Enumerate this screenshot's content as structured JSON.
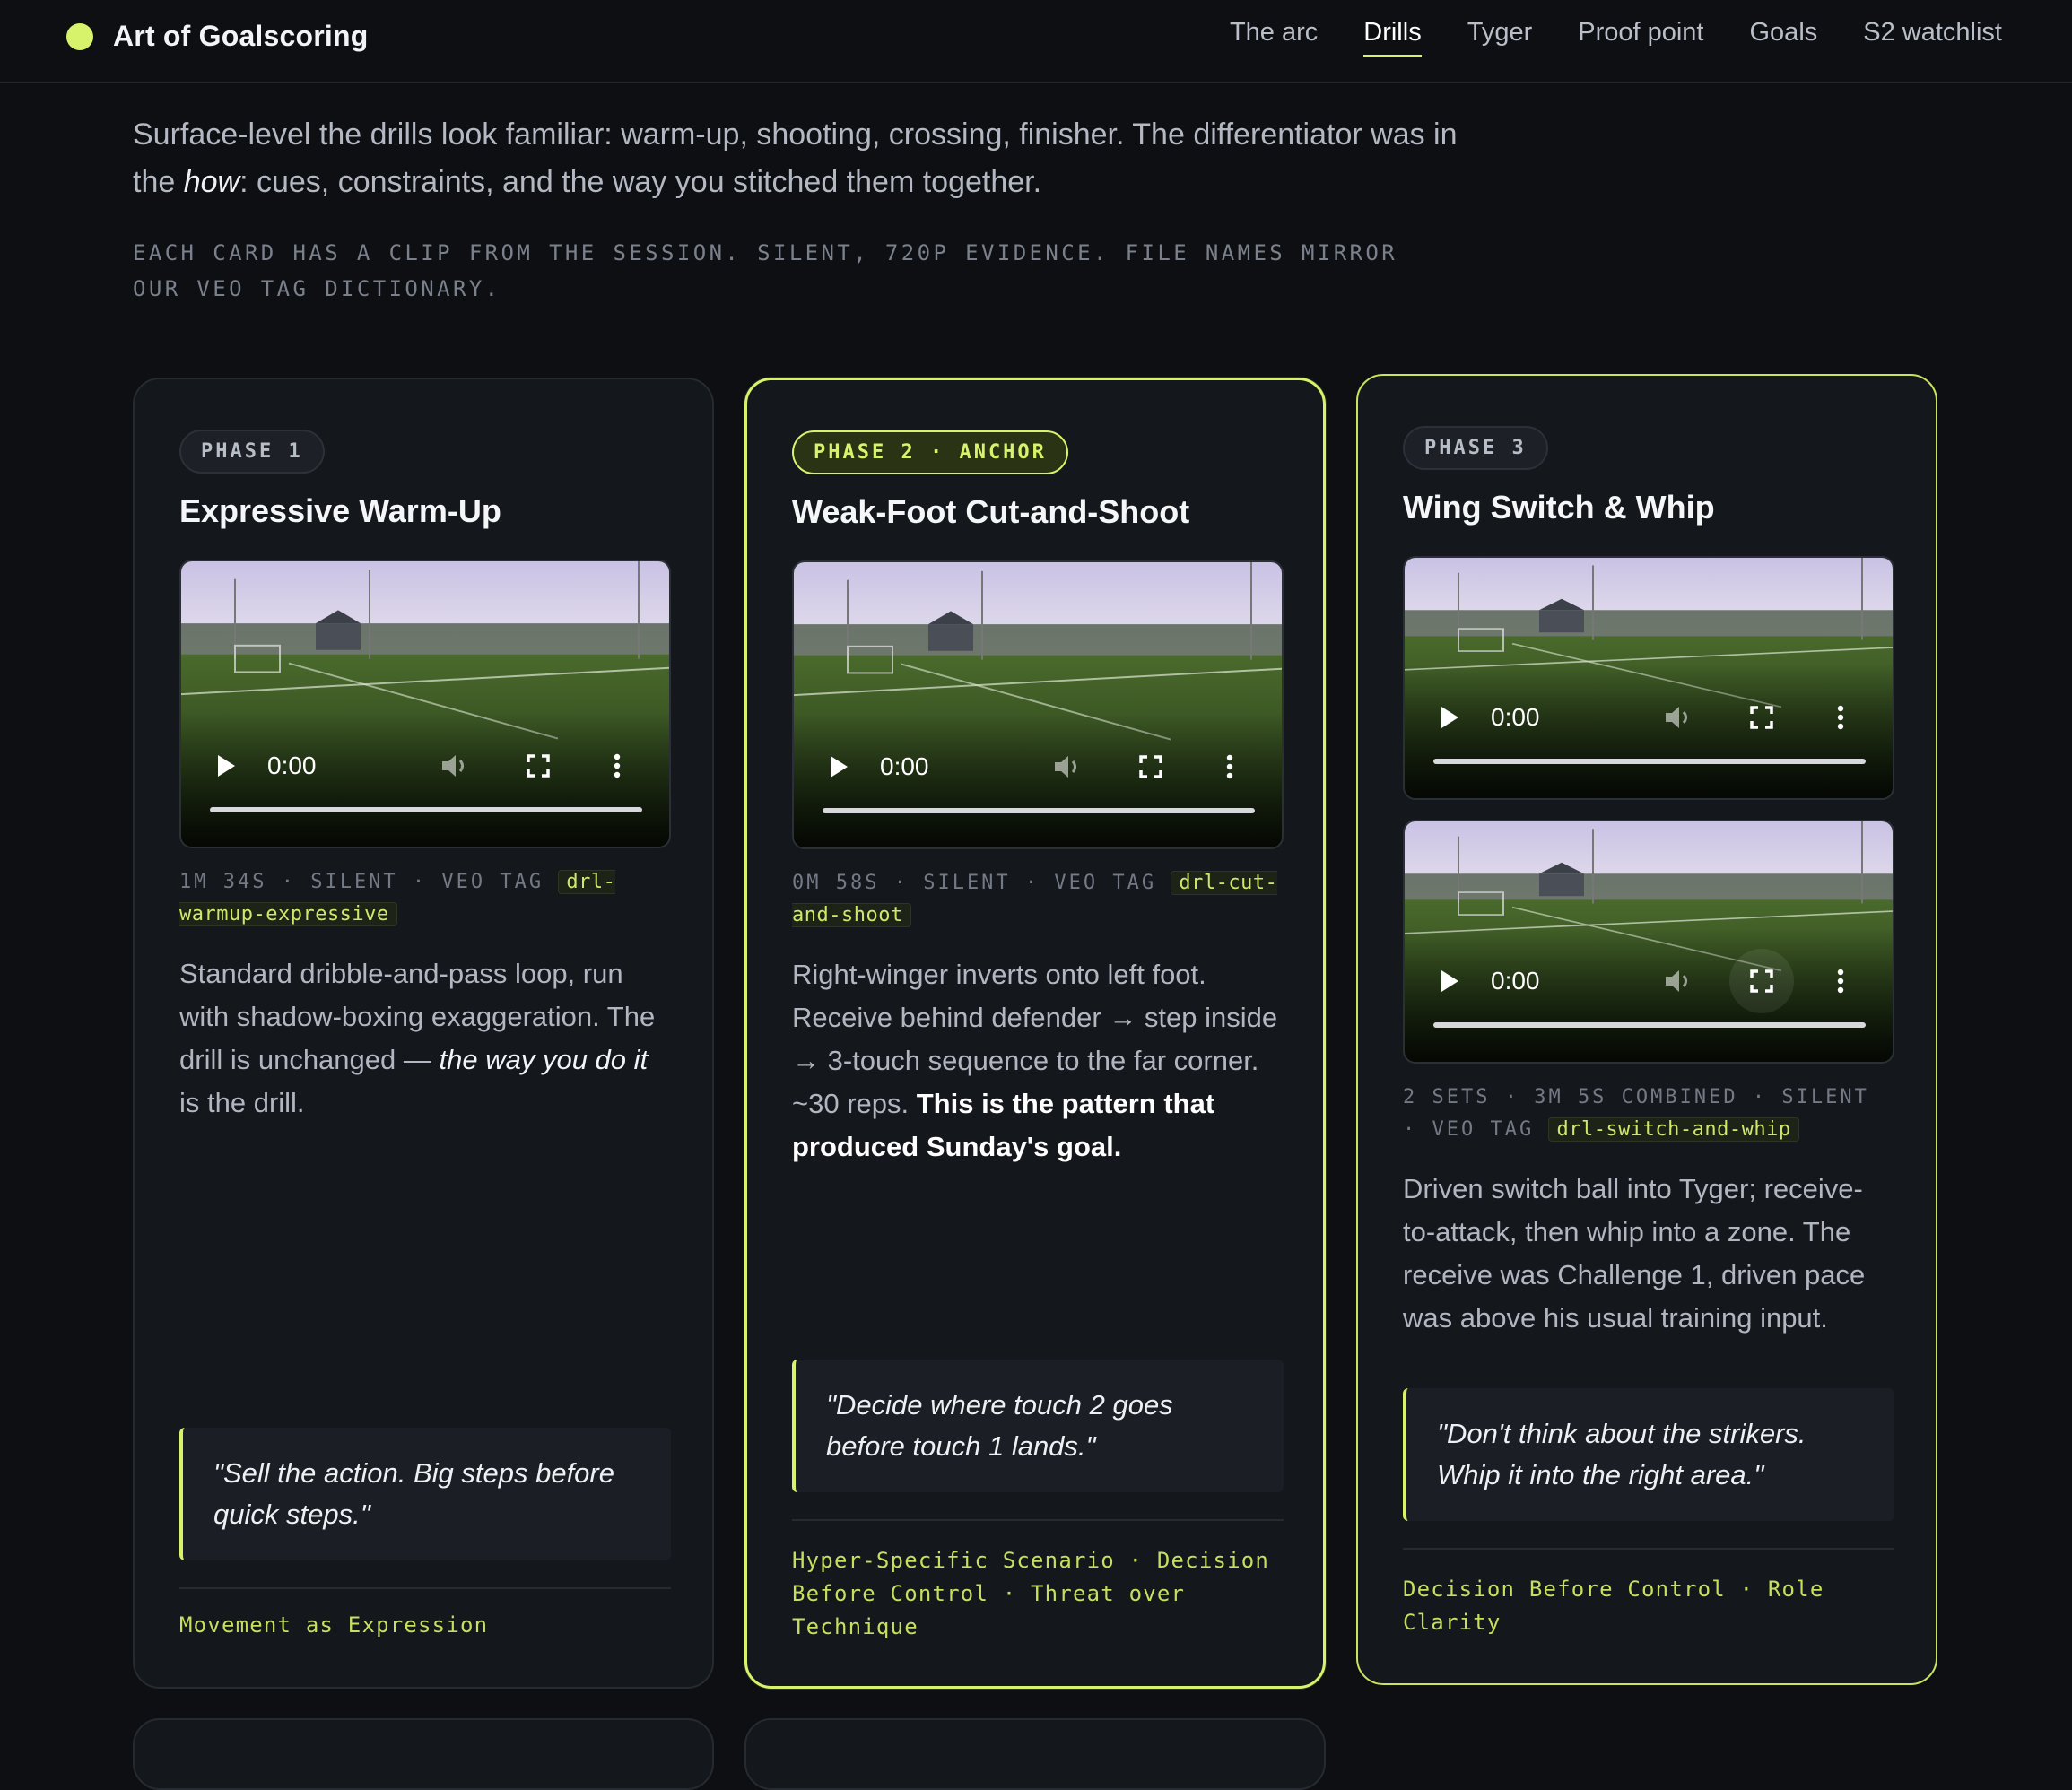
{
  "brand": {
    "name": "Art of Goalscoring",
    "accent": "#d7f36b"
  },
  "nav": {
    "items": [
      "The arc",
      "Drills",
      "Tyger",
      "Proof point",
      "Goals",
      "S2 watchlist"
    ],
    "active": "Drills"
  },
  "intro": {
    "part1": "Surface-level the drills look familiar: warm-up, shooting, crossing, finisher. The differentiator was in the ",
    "em": "how",
    "part2": ": cues, constraints, and the way you stitched them together."
  },
  "note": "Each card has a clip from the session. Silent, 720p evidence. File names mirror our Veo tag dictionary.",
  "cards": [
    {
      "badge": "PHASE 1",
      "title": "Expressive Warm-Up",
      "videos": [
        {
          "time": "0:00"
        }
      ],
      "meta": "1M 34S · SILENT · VEO TAG ",
      "tag": "drl-warmup-expressive",
      "desc": {
        "a": "Standard dribble-and-pass loop, run with shadow-boxing exaggeration. The drill is unchanged — ",
        "em": "the way you do it",
        "b": " is the drill."
      },
      "quote": "\"Sell the action. Big steps before quick steps.\"",
      "themes": "Movement as Expression"
    },
    {
      "badge": "PHASE 2 · ANCHOR",
      "title": "Weak-Foot Cut-and-Shoot",
      "videos": [
        {
          "time": "0:00"
        }
      ],
      "meta": "0M 58S · SILENT · VEO TAG ",
      "tag": "drl-cut-and-shoot",
      "desc": {
        "a": "Right-winger inverts onto left foot. Receive behind defender → step inside → 3-touch sequence to the far corner. ~30 reps. ",
        "strong": "This is the pattern that produced Sunday's goal."
      },
      "quote": "\"Decide where touch 2 goes before touch 1 lands.\"",
      "themes": "Hyper-Specific Scenario · Decision Before Control · Threat over Technique"
    },
    {
      "badge": "PHASE 3",
      "title": "Wing Switch & Whip",
      "videos": [
        {
          "time": "0:00"
        },
        {
          "time": "0:00"
        }
      ],
      "meta": "2 SETS · 3M 5S COMBINED · SILENT · VEO TAG ",
      "tag": "drl-switch-and-whip",
      "desc": {
        "a": "Driven switch ball into Tyger; receive-to-attack, then whip into a zone. The receive was Challenge 1, driven pace was above his usual training input."
      },
      "quote": "\"Don't think about the strikers. Whip it into the right area.\"",
      "themes": "Decision Before Control · Role Clarity"
    }
  ]
}
